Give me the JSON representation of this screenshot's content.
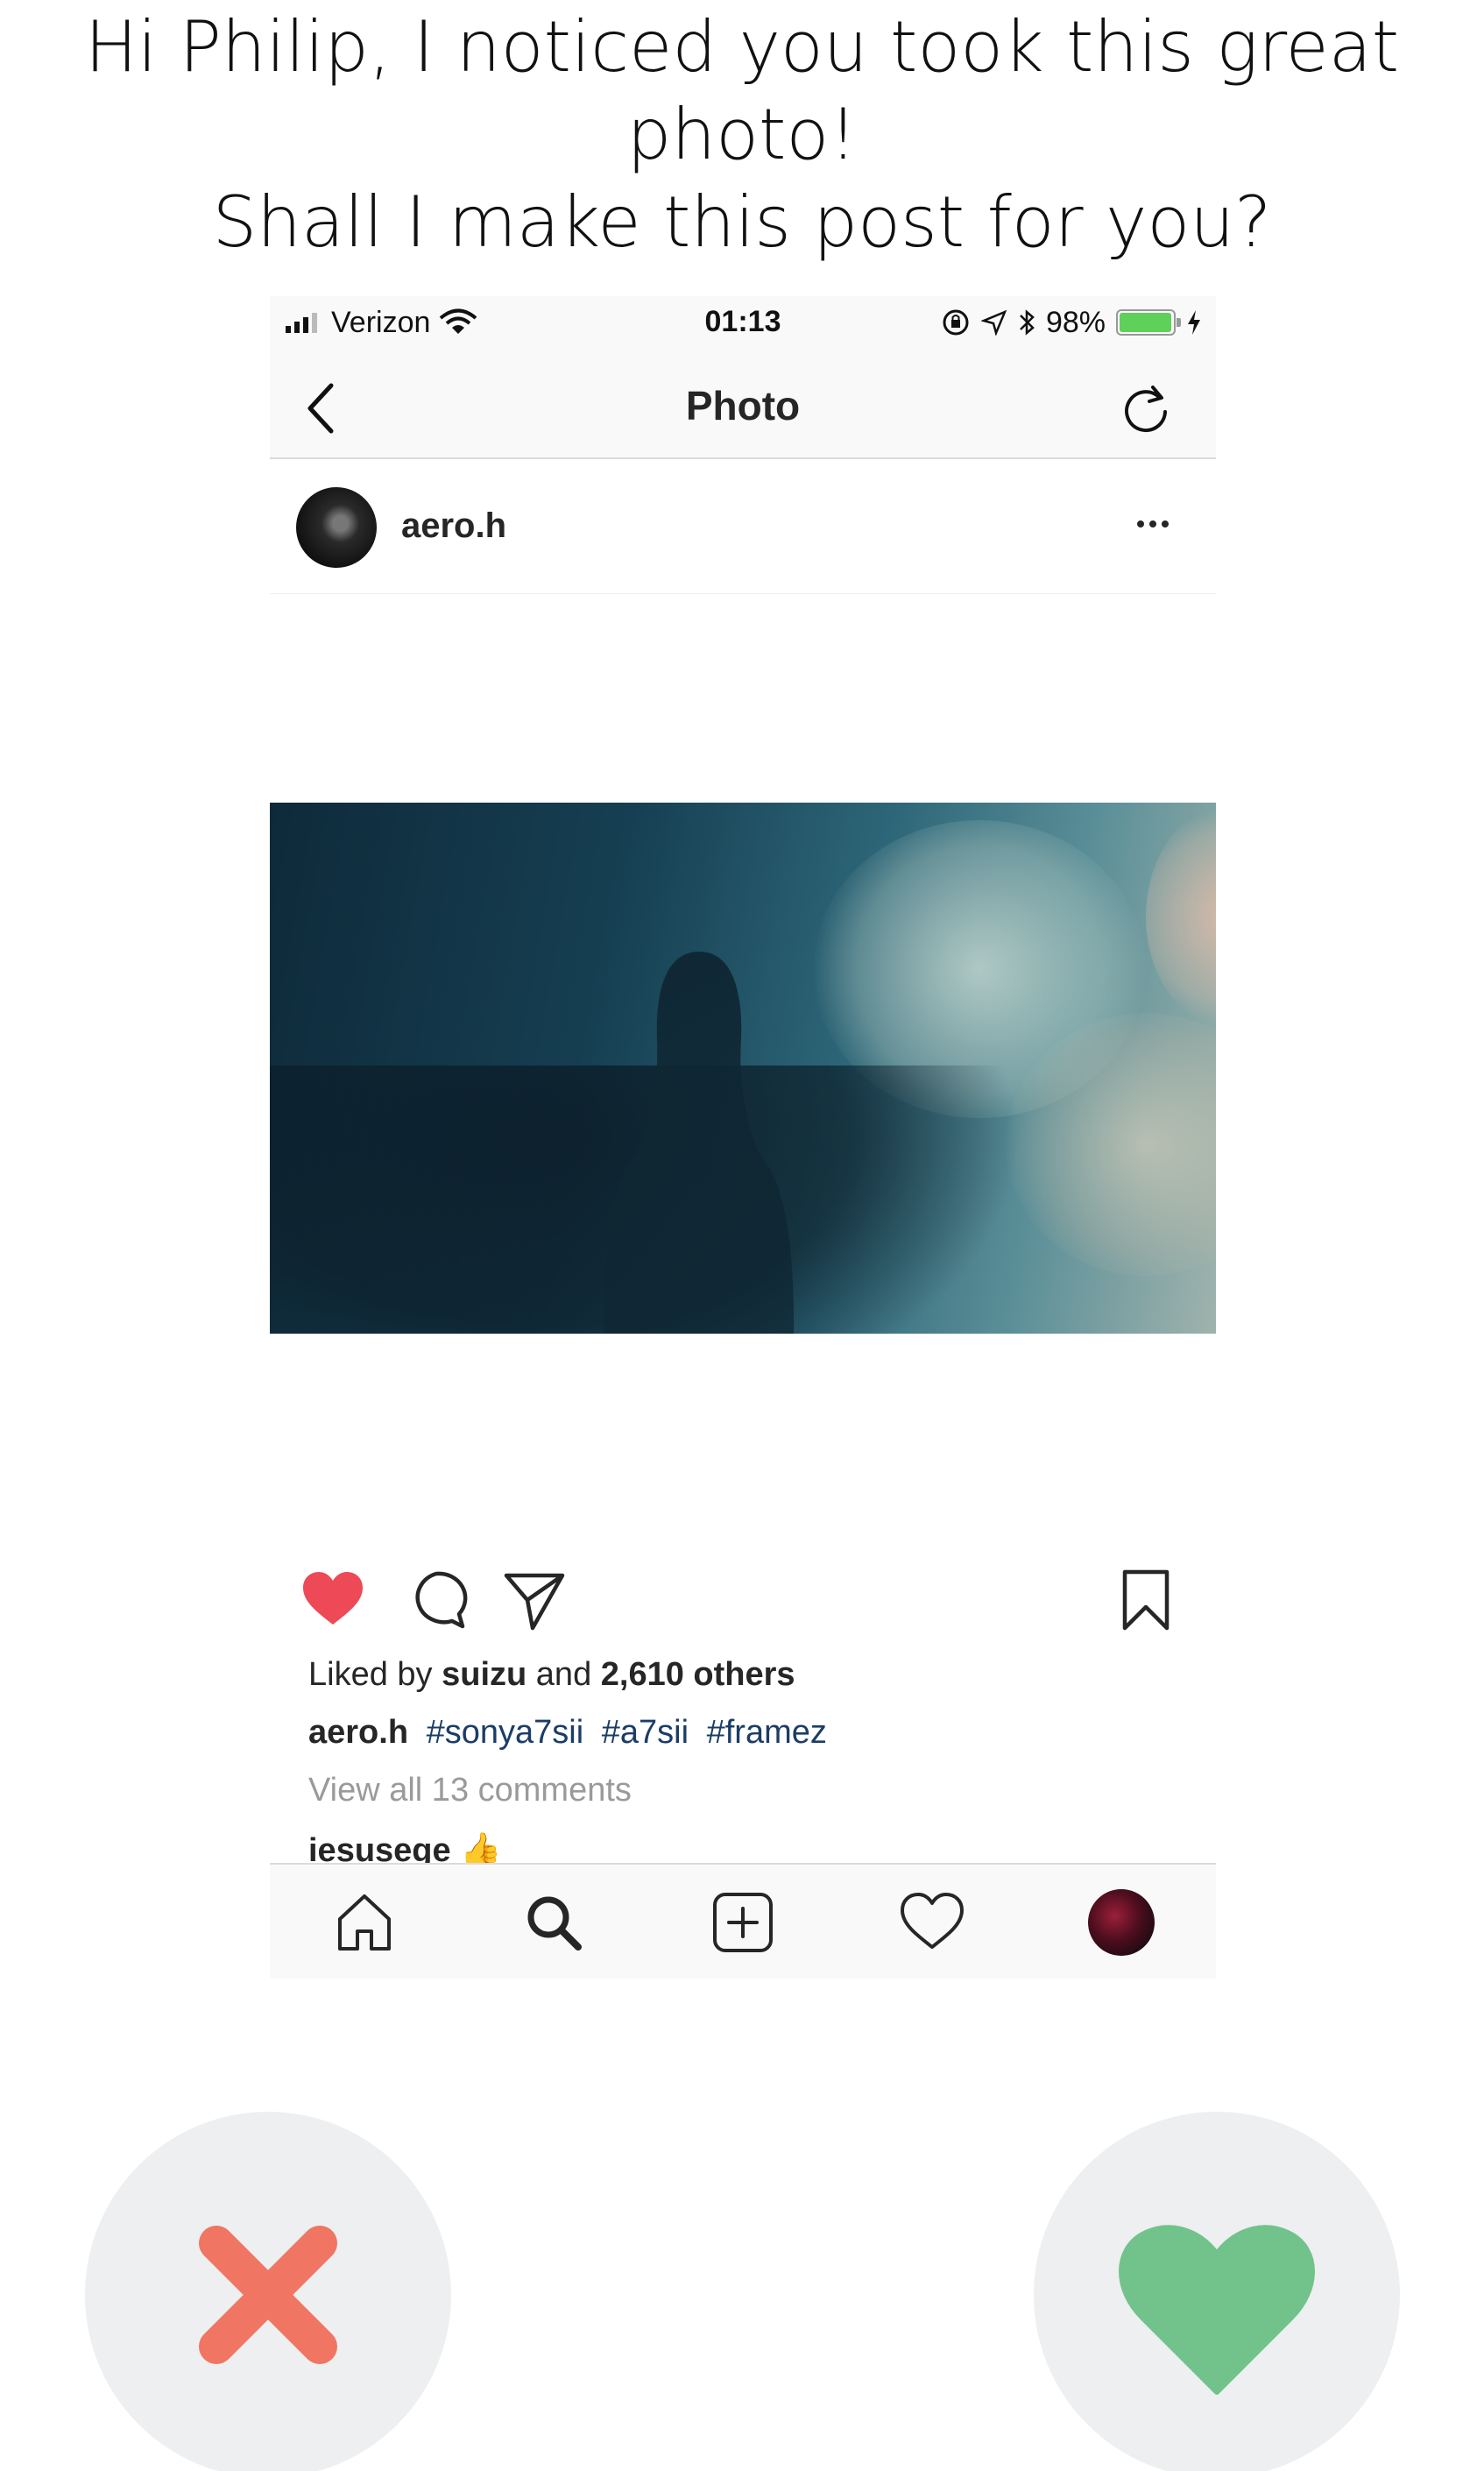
{
  "prompt": {
    "line1": "Hi Philip, I noticed you took this great photo!",
    "line2": "Shall I make this post for you?"
  },
  "status_bar": {
    "carrier": "Verizon",
    "time": "01:13",
    "battery_percent": "98%",
    "battery_level": 0.98
  },
  "nav": {
    "title": "Photo",
    "back_icon": "chevron-left-icon",
    "refresh_icon": "refresh-icon"
  },
  "post": {
    "username": "aero.h",
    "more_icon": "more-icon",
    "likes_prefix": "Liked by",
    "liked_user": "suizu",
    "likes_middle": "and",
    "likes_count": "2,610 others",
    "caption_user": "aero.h",
    "hashtags": [
      "#sonya7sii",
      "#a7sii",
      "#framez"
    ],
    "view_all": "View all 13 comments",
    "comment_peek": "iesusege 👍"
  },
  "tab_bar": [
    "home-icon",
    "search-icon",
    "add-icon",
    "heart-icon",
    "profile-avatar"
  ],
  "decision": {
    "reject_icon": "x-icon",
    "accept_icon": "heart-icon",
    "reject_color": "#f07563",
    "accept_color": "#72c28b"
  },
  "colors": {
    "like_red": "#ed4956",
    "hashtag_blue": "#1b3d66",
    "battery_green": "#5fd05a"
  }
}
